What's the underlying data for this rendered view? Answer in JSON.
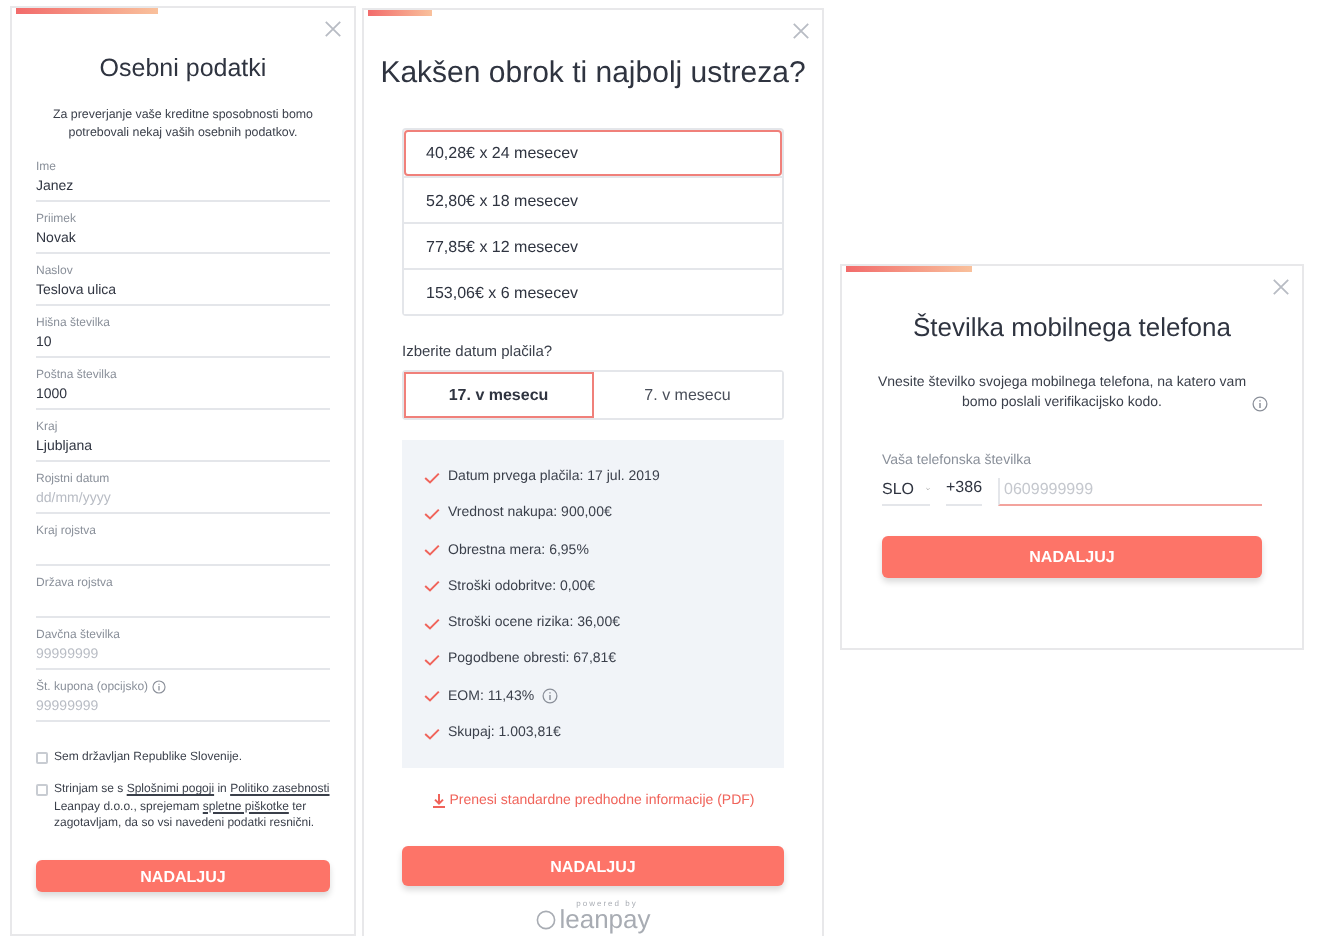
{
  "personal": {
    "title": "Osebni podatki",
    "intro": "Za preverjanje vaše kreditne sposobnosti bomo potrebovali nekaj vaših osebnih podatkov.",
    "fields": [
      {
        "label": "Ime",
        "value": "Janez"
      },
      {
        "label": "Priimek",
        "value": "Novak"
      },
      {
        "label": "Naslov",
        "value": "Teslova ulica"
      },
      {
        "label": "Hišna številka",
        "value": "10"
      },
      {
        "label": "Poštna številka",
        "value": "1000"
      },
      {
        "label": "Kraj",
        "value": "Ljubljana"
      },
      {
        "label": "Rojstni datum",
        "placeholder": "dd/mm/yyyy"
      },
      {
        "label": "Kraj rojstva"
      },
      {
        "label": "Država rojstva"
      },
      {
        "label": "Davčna številka",
        "placeholder": "99999999"
      },
      {
        "label": "Št. kupona (opcijsko)",
        "placeholder": "99999999",
        "info": true
      }
    ],
    "checkboxes": [
      {
        "checked": false,
        "parts": [
          {
            "kind": "text",
            "text": "Sem državljan Republike Slovenije."
          }
        ]
      },
      {
        "checked": false,
        "parts": [
          {
            "kind": "text",
            "text": "Strinjam se s "
          },
          {
            "kind": "link",
            "text": "Splošnimi pogoji"
          },
          {
            "kind": "text",
            "text": " in "
          },
          {
            "kind": "link",
            "text": "Politiko zasebnosti"
          },
          {
            "kind": "text",
            "text": " Leanpay d.o.o., sprejemam "
          },
          {
            "kind": "link",
            "text": "spletne piškotke"
          },
          {
            "kind": "text",
            "text": " ter zagotavljam, da so vsi navedeni podatki resnični."
          }
        ]
      }
    ],
    "button": "NADALJUJ"
  },
  "plan": {
    "title": "Kakšen obrok ti najbolj ustreza?",
    "options": [
      {
        "label": "40,28€ x 24 mesecev",
        "selected": true
      },
      {
        "label": "52,80€ x 18 mesecev",
        "selected": false
      },
      {
        "label": "77,85€ x 12 mesecev",
        "selected": false
      },
      {
        "label": "153,06€ x 6 mesecev",
        "selected": false
      }
    ],
    "date_question": "Izberite datum plačila?",
    "dates": [
      {
        "label": "17. v mesecu",
        "selected": true
      },
      {
        "label": "7. v mesecu",
        "selected": false
      }
    ],
    "summary": [
      {
        "text": "Datum prvega plačila: 17 jul. 2019"
      },
      {
        "text": "Vrednost nakupa: 900,00€"
      },
      {
        "text": "Obrestna mera: 6,95%"
      },
      {
        "text": "Stroški odobritve: 0,00€"
      },
      {
        "text": "Stroški ocene rizika: 36,00€"
      },
      {
        "text": "Pogodbene obresti: 67,81€"
      },
      {
        "text": "EOM: 11,43%",
        "info": true
      },
      {
        "text": "Skupaj: 1.003,81€"
      }
    ],
    "download_link": "Prenesi standardne predhodne informacije (PDF)",
    "button": "NADALJUJ",
    "footer": {
      "caption": "powered by",
      "logo": "leanpay"
    }
  },
  "phone": {
    "title": "Številka mobilnega telefona",
    "intro": "Vnesite številko svojega mobilnega telefona, na katero vam bomo poslali verifikacijsko kodo.",
    "label": "Vaša telefonska številka",
    "country": "SLO",
    "prefix": "+386",
    "placeholder": "0609999999",
    "button": "NADALJUJ"
  }
}
